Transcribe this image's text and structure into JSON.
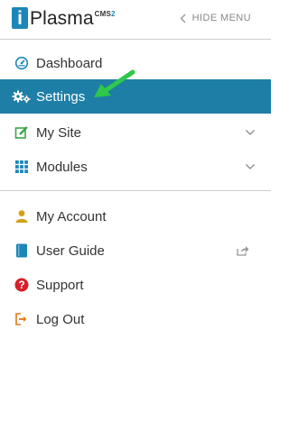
{
  "header": {
    "logo_mark": "i",
    "logo_text": "Plasma",
    "logo_sup_cms": "CMS",
    "logo_sup_num": "2",
    "hide_menu_label": "HIDE MENU"
  },
  "nav": {
    "primary": [
      {
        "label": "Dashboard",
        "icon": "dashboard-icon",
        "active": false
      },
      {
        "label": "Settings",
        "icon": "gear-icon",
        "active": true
      },
      {
        "label": "My Site",
        "icon": "edit-icon",
        "expandable": true
      },
      {
        "label": "Modules",
        "icon": "grid-icon",
        "expandable": true
      }
    ],
    "secondary": [
      {
        "label": "My Account",
        "icon": "user-icon"
      },
      {
        "label": "User Guide",
        "icon": "book-icon",
        "external": true
      },
      {
        "label": "Support",
        "icon": "help-icon"
      },
      {
        "label": "Log Out",
        "icon": "logout-icon"
      }
    ]
  },
  "colors": {
    "brand": "#1c86b8",
    "active_bg": "#1e7ea6",
    "annotation_arrow": "#2ec84a"
  }
}
